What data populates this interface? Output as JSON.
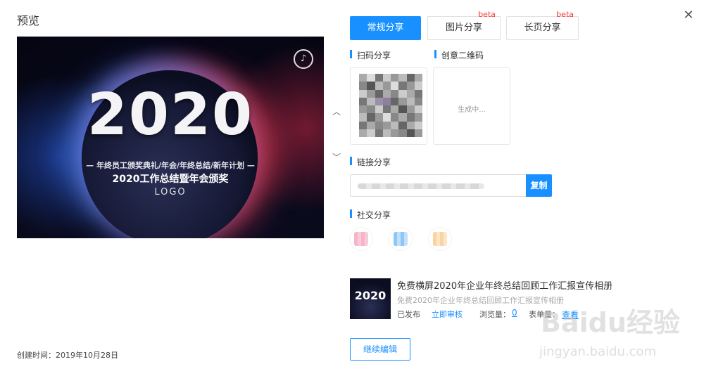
{
  "header": {
    "title": "预览",
    "close_icon": "close-icon"
  },
  "poster": {
    "year": "2020",
    "subtitle": "— 年终员工颁奖典礼/年会/年终总结/新年计划 —",
    "main_title": "2020工作总结暨年会颁奖",
    "logo_text": "LOGO",
    "music_icon": "music-icon"
  },
  "created_time": "创建时间：2019年10月28日",
  "tabs": [
    {
      "label": "常规分享",
      "active": true,
      "beta": ""
    },
    {
      "label": "图片分享",
      "active": false,
      "beta": "beta"
    },
    {
      "label": "长页分享",
      "active": false,
      "beta": "beta"
    }
  ],
  "sections": {
    "scan_share": "扫码分享",
    "creative_qr": "创意二维码",
    "generating": "生成中...",
    "link_share": "链接分享",
    "copy_button": "复制",
    "social_share": "社交分享"
  },
  "work": {
    "thumb_text": "2020",
    "title": "免费横屏2020年企业年终总结回顾工作汇报宣传相册",
    "subtitle": "免费2020年企业年终总结回顾工作汇报宣传相册",
    "status": "已发布",
    "review_link": "立即审核",
    "views_label": "浏览量：",
    "views_value": "0",
    "forms_label": "表单量：",
    "forms_link": "查看"
  },
  "continue_button": "继续编辑",
  "watermark": {
    "main": "Baidu经验",
    "sub": "jingyan.baidu.com"
  },
  "colors": {
    "accent": "#1890ff",
    "beta": "#ff3333"
  }
}
